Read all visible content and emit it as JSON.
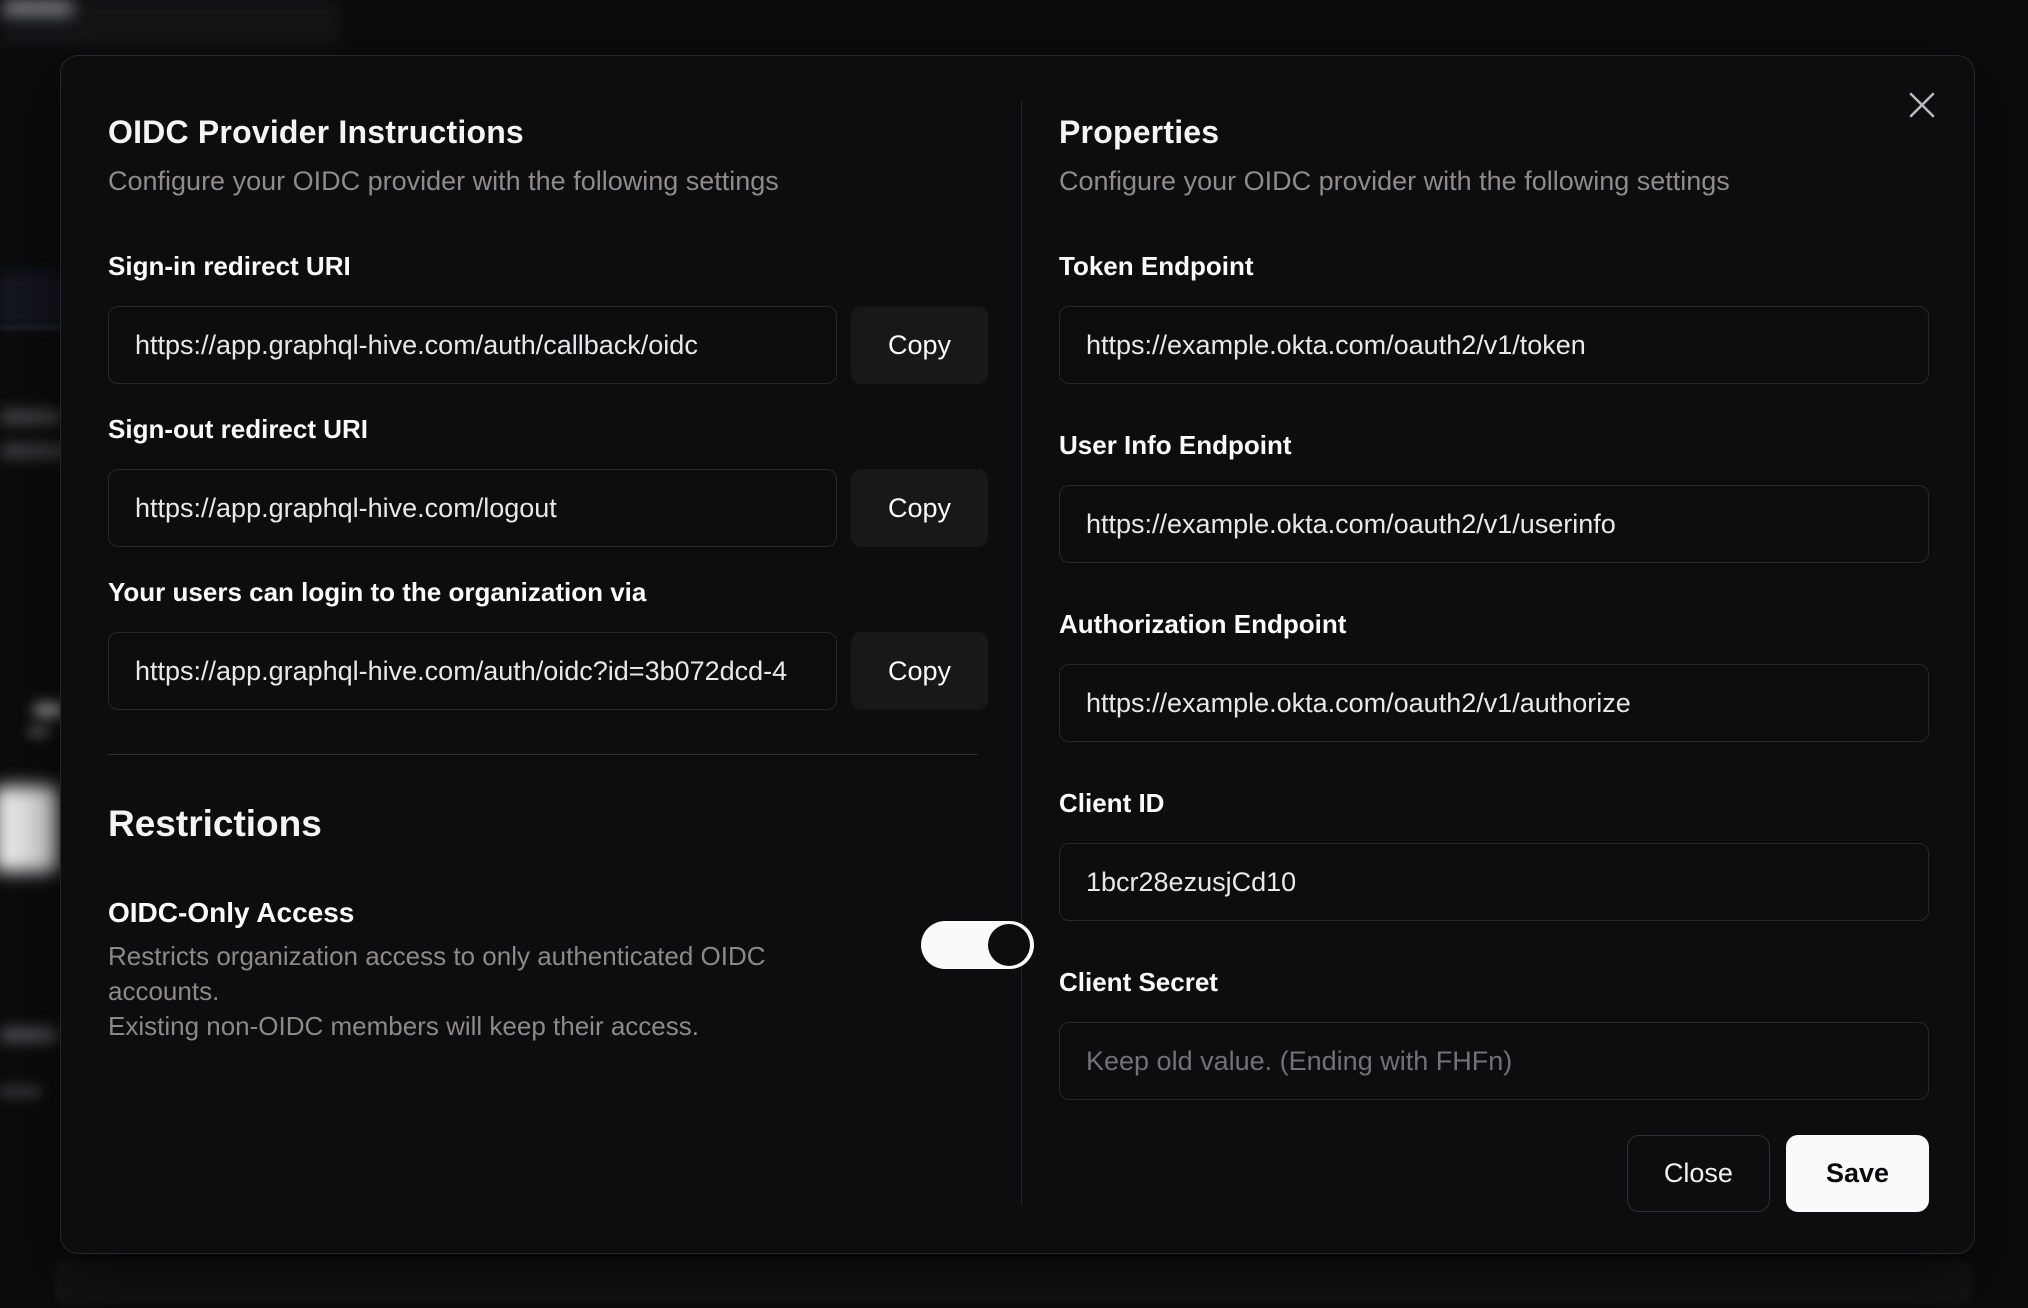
{
  "left": {
    "title": "OIDC Provider Instructions",
    "subtitle": "Configure your OIDC provider with the following settings",
    "fields": [
      {
        "label": "Sign-in redirect URI",
        "value": "https://app.graphql-hive.com/auth/callback/oidc",
        "action": "Copy"
      },
      {
        "label": "Sign-out redirect URI",
        "value": "https://app.graphql-hive.com/logout",
        "action": "Copy"
      },
      {
        "label": "Your users can login to the organization via",
        "value": "https://app.graphql-hive.com/auth/oidc?id=3b072dcd-4",
        "action": "Copy"
      }
    ],
    "restrictions": {
      "title": "Restrictions",
      "toggle_label": "OIDC-Only Access",
      "description_line1": "Restricts organization access to only authenticated OIDC accounts.",
      "description_line2": "Existing non-OIDC members will keep their access.",
      "toggle_state": "on"
    }
  },
  "right": {
    "title": "Properties",
    "subtitle": "Configure your OIDC provider with the following settings",
    "fields": [
      {
        "label": "Token Endpoint",
        "value": "https://example.okta.com/oauth2/v1/token"
      },
      {
        "label": "User Info Endpoint",
        "value": "https://example.okta.com/oauth2/v1/userinfo"
      },
      {
        "label": "Authorization Endpoint",
        "value": "https://example.okta.com/oauth2/v1/authorize"
      },
      {
        "label": "Client ID",
        "value": "1bcr28ezusjCd10"
      },
      {
        "label": "Client Secret",
        "value": "",
        "placeholder": "Keep old value. (Ending with FHFn)"
      }
    ],
    "buttons": {
      "close": "Close",
      "save": "Save"
    }
  },
  "colors": {
    "modal_background": "#0d0d10",
    "input_border": "#2b2824",
    "copy_button_background": "#18181b",
    "toggle_track": "#fafafa",
    "toggle_knob": "#0d0d10",
    "save_button_background": "#fafafa",
    "muted_text": "#8e8c8a"
  }
}
